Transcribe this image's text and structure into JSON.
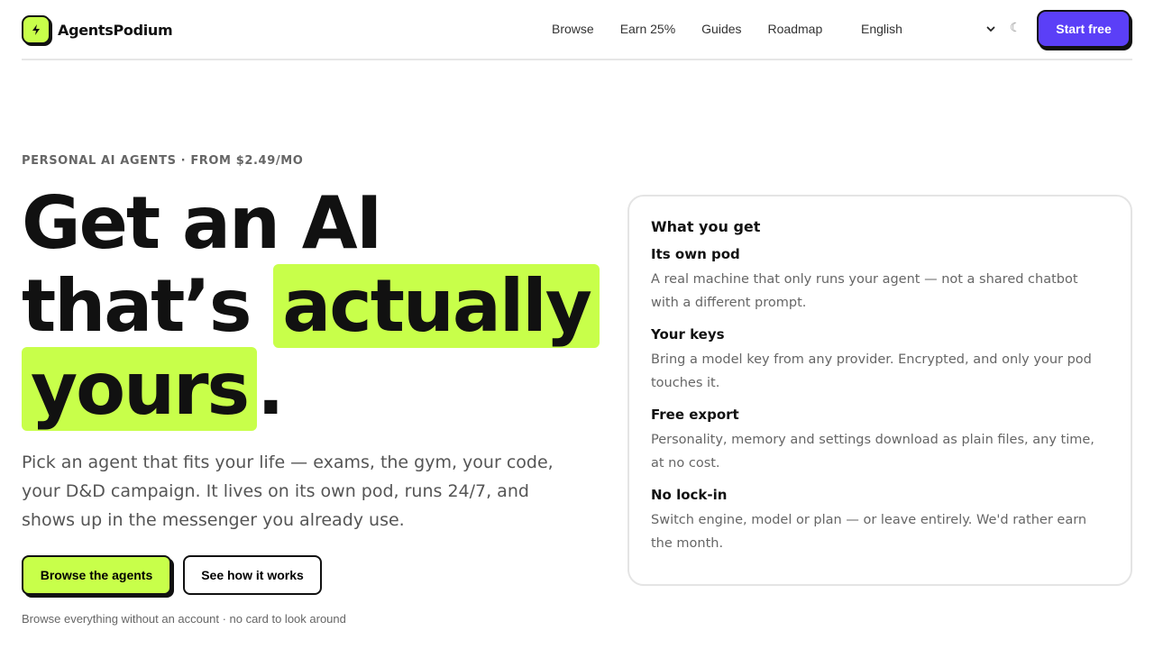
{
  "brand": {
    "name": "AgentsPodium",
    "icon": "lightning-bolt-icon",
    "accent": "#c8ff4a"
  },
  "nav": {
    "items": [
      {
        "label": "Browse"
      },
      {
        "label": "Earn 25%"
      },
      {
        "label": "Guides"
      },
      {
        "label": "Roadmap"
      }
    ],
    "language": "English",
    "theme_icon": "moon-icon",
    "theme_glyph": "☾",
    "cta_label": "Start free",
    "cta_color": "#5b3ff7"
  },
  "hero": {
    "eyebrow": "PERSONAL AI AGENTS · FROM $2.49/MO",
    "headline_part1": "Get an AI",
    "headline_part2": "that’s ",
    "headline_highlight1": "actually",
    "headline_highlight2": "yours",
    "headline_end": ".",
    "subtitle": "Pick an agent that fits your life — exams, the gym, your code, your D&D campaign. It lives on its own pod, runs 24/7, and shows up in the messenger you already use.",
    "primary_button": "Browse the agents",
    "secondary_button": "See how it works",
    "footnote": "Browse everything without an account · no card to look around"
  },
  "card": {
    "title": "What you get",
    "features": [
      {
        "title": "Its own pod",
        "desc": "A real machine that only runs your agent — not a shared chatbot with a different prompt."
      },
      {
        "title": "Your keys",
        "desc": "Bring a model key from any provider. Encrypted, and only your pod touches it."
      },
      {
        "title": "Free export",
        "desc": "Personality, memory and settings download as plain files, any time, at no cost."
      },
      {
        "title": "No lock-in",
        "desc": "Switch engine, model or plan — or leave entirely. We'd rather earn the month."
      }
    ]
  }
}
